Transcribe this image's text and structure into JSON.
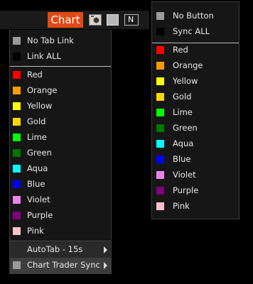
{
  "toolbar": {
    "chart_tab_label": "Chart",
    "n_button_label": "N"
  },
  "left_menu": {
    "header_items": [
      {
        "label": "No Tab Link",
        "color": "#9a9a9a"
      },
      {
        "label": "Link ALL",
        "color": "#000000"
      }
    ],
    "colors": [
      {
        "label": "Red",
        "color": "#ff0000"
      },
      {
        "label": "Orange",
        "color": "#ff9a00"
      },
      {
        "label": "Yellow",
        "color": "#ffff00"
      },
      {
        "label": "Gold",
        "color": "#ffd700"
      },
      {
        "label": "Lime",
        "color": "#00ff00"
      },
      {
        "label": "Green",
        "color": "#007800"
      },
      {
        "label": "Aqua",
        "color": "#00ffff"
      },
      {
        "label": "Blue",
        "color": "#0000ff"
      },
      {
        "label": "Violet",
        "color": "#ee82ee"
      },
      {
        "label": "Purple",
        "color": "#800080"
      },
      {
        "label": "Pink",
        "color": "#ffc0cb"
      }
    ],
    "autotab_label": "AutoTab - 15s",
    "trader_sync_label": "Chart Trader Sync"
  },
  "right_menu": {
    "header_items": [
      {
        "label": "No Button",
        "color": "#9a9a9a"
      },
      {
        "label": "Sync ALL",
        "color": "#000000"
      }
    ],
    "colors": [
      {
        "label": "Red",
        "color": "#ff0000"
      },
      {
        "label": "Orange",
        "color": "#ff9a00"
      },
      {
        "label": "Yellow",
        "color": "#ffff00"
      },
      {
        "label": "Gold",
        "color": "#ffd700"
      },
      {
        "label": "Lime",
        "color": "#00ff00"
      },
      {
        "label": "Green",
        "color": "#007800"
      },
      {
        "label": "Aqua",
        "color": "#00ffff"
      },
      {
        "label": "Blue",
        "color": "#0000ff"
      },
      {
        "label": "Violet",
        "color": "#ee82ee"
      },
      {
        "label": "Purple",
        "color": "#800080"
      },
      {
        "label": "Pink",
        "color": "#ffc0cb"
      }
    ]
  }
}
